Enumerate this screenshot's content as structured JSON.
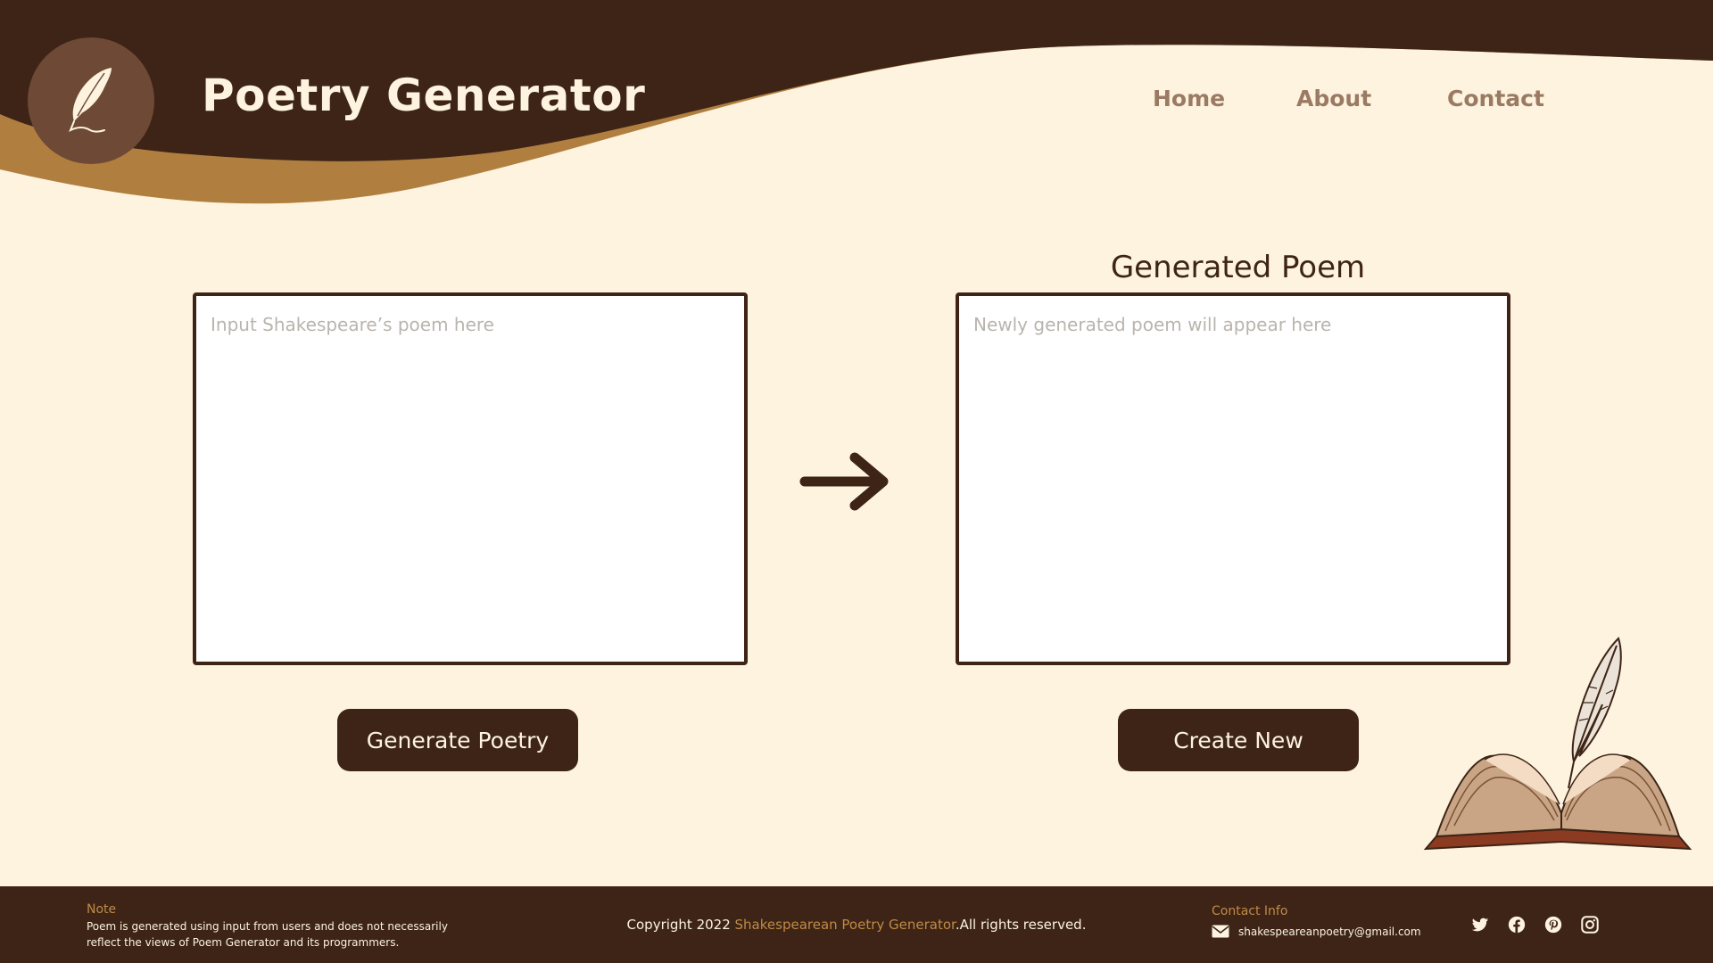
{
  "header": {
    "title": "Poetry Generator",
    "logo_icon": "feather-quill-icon",
    "nav": [
      {
        "label": "Home"
      },
      {
        "label": "About"
      },
      {
        "label": "Contact"
      }
    ]
  },
  "input_panel": {
    "placeholder": "Input Shakespeare’s poem here",
    "value": ""
  },
  "output_panel": {
    "title": "Generated Poem",
    "placeholder": "Newly generated poem will appear here",
    "value": ""
  },
  "arrow_icon": "arrow-right-icon",
  "buttons": {
    "generate": "Generate Poetry",
    "create_new": "Create New"
  },
  "illustration": "open-book-with-quill-icon",
  "footer": {
    "note_label": "Note",
    "note_text": "Poem is generated using input from users and does not necessarily reflect the views of Poem Generator and its programmers.",
    "copyright_prefix": "Copyright 2022 ",
    "copyright_brand": "Shakespearean Poetry Generator",
    "copyright_suffix": ".All rights reserved.",
    "contact_label": "Contact Info",
    "email": "shakespeareanpoetry@gmail.com",
    "email_icon": "envelope-icon",
    "socials": [
      "twitter-icon",
      "facebook-icon",
      "pinterest-icon",
      "instagram-icon"
    ]
  },
  "colors": {
    "dark_brown": "#3d2416",
    "gold": "#b07f3f",
    "cream": "#fdf3df",
    "logo_circle": "#6e4a36",
    "nav_text": "#9a7a63",
    "accent_text": "#c08a46"
  }
}
